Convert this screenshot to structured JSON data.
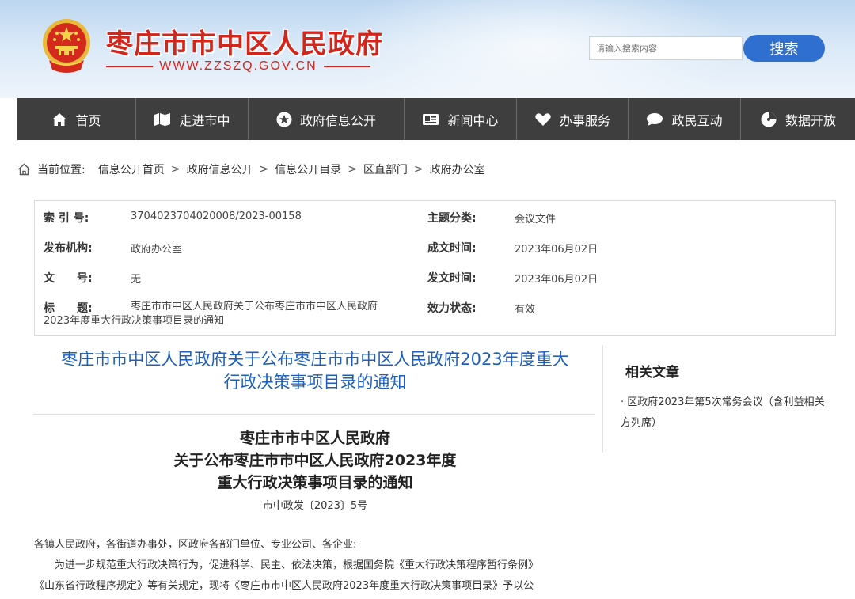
{
  "header": {
    "site_title": "枣庄市市中区人民政府",
    "site_url": "WWW.ZZSZQ.GOV.CN",
    "search_placeholder": "请输入搜索内容",
    "search_button": "搜索"
  },
  "nav": {
    "items": [
      {
        "label": "首页",
        "icon": "home-icon"
      },
      {
        "label": "走进市中",
        "icon": "map-icon"
      },
      {
        "label": "政府信息公开",
        "icon": "star-icon"
      },
      {
        "label": "新闻中心",
        "icon": "news-icon"
      },
      {
        "label": "办事服务",
        "icon": "heart-icon"
      },
      {
        "label": "政民互动",
        "icon": "chat-icon"
      },
      {
        "label": "数据开放",
        "icon": "data-icon"
      }
    ]
  },
  "breadcrumb": {
    "prefix": "当前位置:",
    "items": [
      "信息公开首页",
      "政府信息公开",
      "信息公开目录",
      "区直部门",
      "政府办公室"
    ],
    "separator": ">"
  },
  "meta": {
    "index_label": "索 引 号:",
    "index_value": "3704023704020008/2023-00158",
    "category_label": "主题分类:",
    "category_value": "会议文件",
    "publisher_label": "发布机构:",
    "publisher_value": "政府办公室",
    "created_label": "成文时间:",
    "created_value": "2023年06月02日",
    "docno_label": "文　　号:",
    "docno_value": "无",
    "published_label": "发文时间:",
    "published_value": "2023年06月02日",
    "title_label": "标　　题:",
    "title_value_1": "枣庄市市中区人民政府关于公布枣庄市市中区人民政府",
    "title_value_2": "2023年度重大行政决策事项目录的通知",
    "status_label": "效力状态:",
    "status_value": "有效"
  },
  "article": {
    "title_line1": "枣庄市市中区人民政府关于公布枣庄市市中区人民政府2023年度重大",
    "title_line2": "行政决策事项目录的通知",
    "doc_head_1": "枣庄市市中区人民政府",
    "doc_head_2": "关于公布枣庄市市中区人民政府2023年度",
    "doc_head_3": "重大行政决策事项目录的通知",
    "doc_no": "市中政发〔2023〕5号",
    "para_1": "各镇人民政府，各街道办事处，区政府各部门单位、专业公司、各企业:",
    "para_2": "为进一步规范重大行政决策行为，促进科学、民主、依法决策，根据国务院《重大行政决策程序暂行条例》",
    "para_3": "《山东省行政程序规定》等有关规定，现将《枣庄市市中区人民政府2023年度重大行政决策事项目录》予以公"
  },
  "sidebar": {
    "title": "相关文章",
    "links": [
      {
        "text": "· 区政府2023年第5次常务会议（含利益相关方列席）"
      }
    ]
  },
  "colors": {
    "brand_red": "#d2261d",
    "nav_bg": "#3e3e3e",
    "search_blue": "#2f6fcf",
    "title_blue": "#1e5fbd"
  }
}
